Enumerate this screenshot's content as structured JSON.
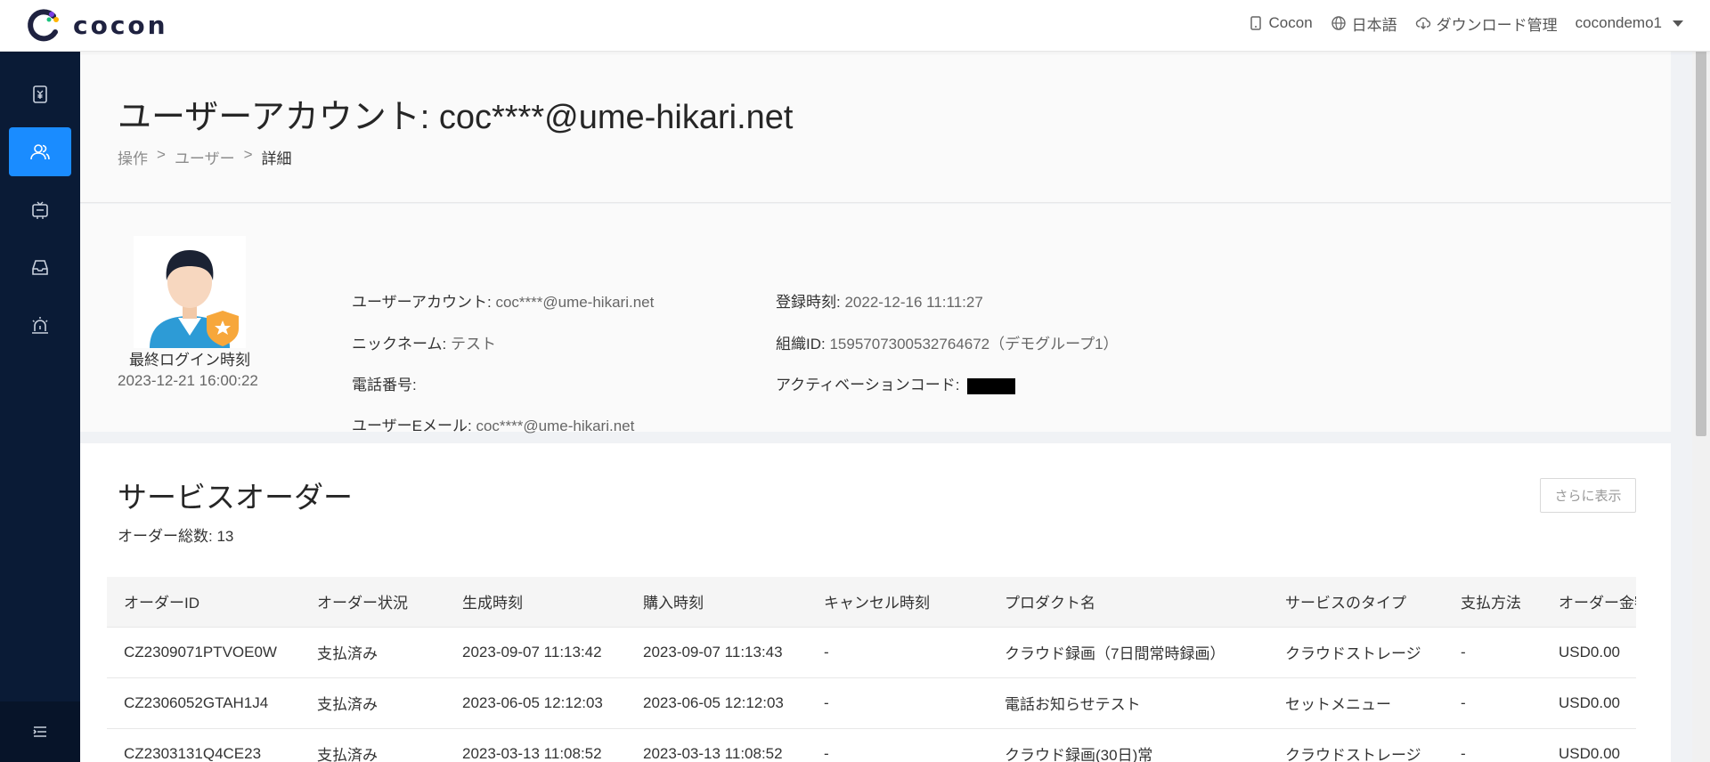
{
  "header": {
    "logo_text": "cocon",
    "device_label": "Cocon",
    "language": "日本語",
    "download_label": "ダウンロード管理",
    "user": "cocondemo1"
  },
  "sidebar": {
    "items": [
      {
        "icon": "billing-icon",
        "active": false
      },
      {
        "icon": "users-icon",
        "active": true
      },
      {
        "icon": "device-icon",
        "active": false
      },
      {
        "icon": "inbox-icon",
        "active": false
      },
      {
        "icon": "alarm-icon",
        "active": false
      }
    ],
    "collapse_icon": "menu-collapse-icon"
  },
  "page": {
    "title": "ユーザーアカウント: coc****@ume-hikari.net",
    "breadcrumb": [
      "操作",
      "ユーザー",
      "詳細"
    ],
    "breadcrumb_sep": ">"
  },
  "profile": {
    "last_login_label": "最終ログイン時刻",
    "last_login_value": "2023-12-21 16:00:22",
    "account_label": "ユーザーアカウント:",
    "account_value": "coc****@ume-hikari.net",
    "nickname_label": "ニックネーム:",
    "nickname_value": "テスト",
    "phone_label": "電話番号:",
    "phone_value": "",
    "email_label": "ユーザーEメール:",
    "email_value": "coc****@ume-hikari.net",
    "registered_label": "登録時刻:",
    "registered_value": "2022-12-16 11:11:27",
    "org_label": "組織ID:",
    "org_value": "1595707300532764672（デモグループ1）",
    "activation_label": "アクティベーションコード:"
  },
  "orders": {
    "title": "サービスオーダー",
    "count_label": "オーダー総数: 13",
    "more_button": "さらに表示",
    "columns": [
      "オーダーID",
      "オーダー状況",
      "生成時刻",
      "購入時刻",
      "キャンセル時刻",
      "プロダクト名",
      "サービスのタイプ",
      "支払方法",
      "オーダー金額"
    ],
    "rows": [
      [
        "CZ2309071PTVOE0W",
        "支払済み",
        "2023-09-07 11:13:42",
        "2023-09-07 11:13:43",
        "-",
        "クラウド録画（7日間常時録画）",
        "クラウドストレージ",
        "-",
        "USD0.00"
      ],
      [
        "CZ2306052GTAH1J4",
        "支払済み",
        "2023-06-05 12:12:03",
        "2023-06-05 12:12:03",
        "-",
        "電話お知らせテスト",
        "セットメニュー",
        "-",
        "USD0.00"
      ],
      [
        "CZ2303131Q4CE23",
        "支払済み",
        "2023-03-13 11:08:52",
        "2023-03-13 11:08:52",
        "-",
        "クラウド録画(30日)常",
        "クラウドストレージ",
        "-",
        "USD0.00"
      ]
    ]
  }
}
